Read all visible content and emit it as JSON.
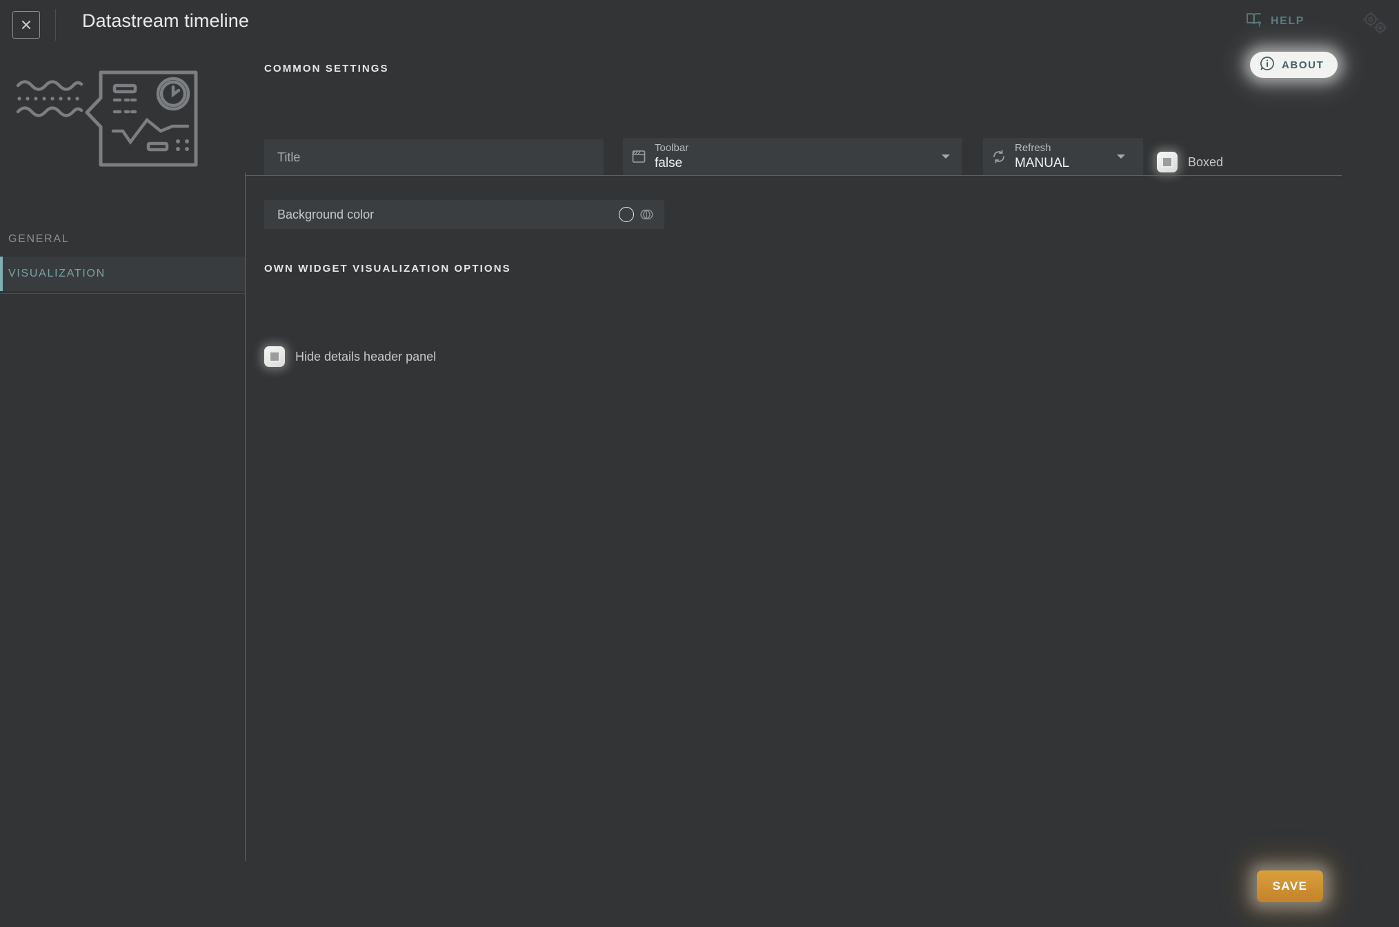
{
  "window": {
    "title": "Datastream timeline",
    "close_icon": "close-x-icon"
  },
  "header": {
    "help_label": "HELP",
    "help_icon": "book-question-icon",
    "gears_icon": "gears-icon",
    "about_label": "ABOUT",
    "about_icon": "info-bubble-icon"
  },
  "sidebar": {
    "preview_icon": "datastream-widget-illustration",
    "items": [
      {
        "label": "GENERAL",
        "active": false
      },
      {
        "label": "VISUALIZATION",
        "active": true
      }
    ]
  },
  "main": {
    "common_settings_heading": "COMMON SETTINGS",
    "title_field": {
      "placeholder": "Title",
      "value": ""
    },
    "toolbar_select": {
      "label": "Toolbar",
      "value": "false",
      "icon": "window-toolbar-icon",
      "options": [
        "true",
        "false"
      ]
    },
    "refresh_select": {
      "label": "Refresh",
      "value": "MANUAL",
      "icon": "refresh-cycle-icon",
      "options": [
        "MANUAL"
      ]
    },
    "boxed_checkbox": {
      "label": "Boxed",
      "checked": false
    },
    "background_color": {
      "label": "Background color",
      "swatch_color": "transparent",
      "palette_icon": "color-palette-icon"
    },
    "own_options_heading": "OWN WIDGET VISUALIZATION OPTIONS",
    "hide_details_checkbox": {
      "label": "Hide details header panel",
      "checked": false
    }
  },
  "footer": {
    "save_label": "SAVE"
  },
  "colors": {
    "page_background": "#323436",
    "field_background": "#3b3e40",
    "accent_teal": "#76a3a7",
    "save_orange": "#d09030",
    "text_primary": "#e9eaeb",
    "text_muted": "#8b9094"
  }
}
